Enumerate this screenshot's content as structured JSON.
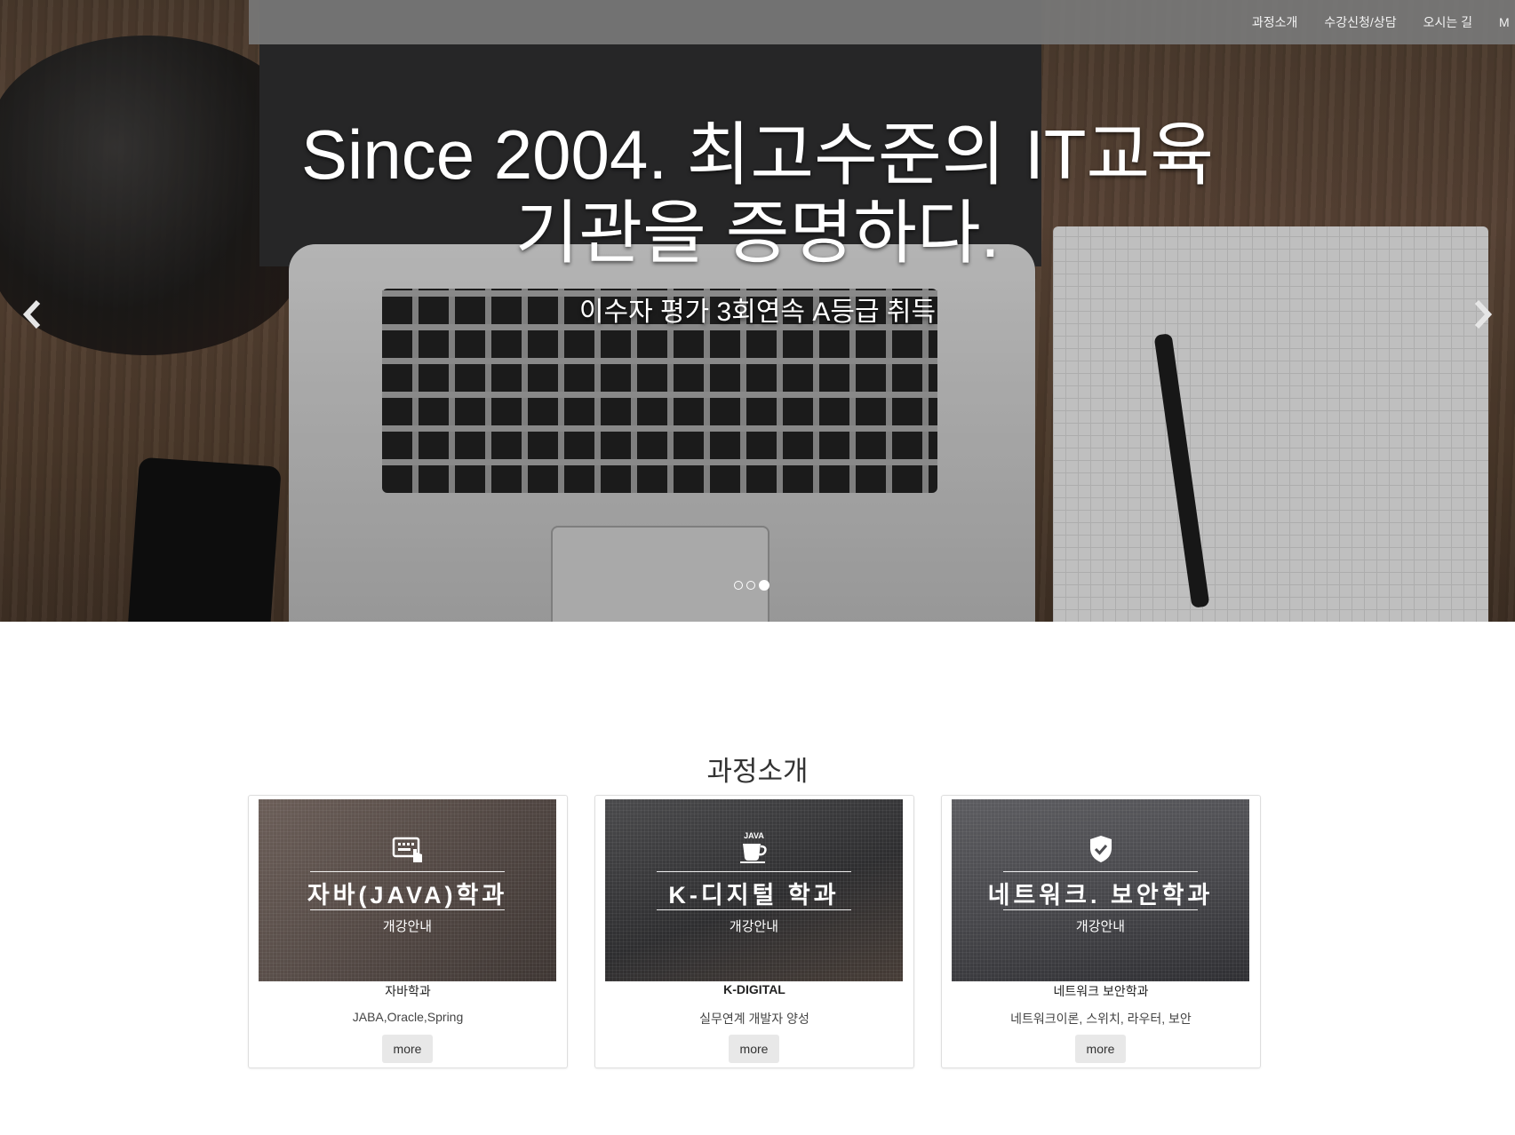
{
  "nav": {
    "items": [
      "과정소개",
      "수강신청/상담",
      "오시는 길",
      "M"
    ]
  },
  "hero": {
    "headline_line1": "Since 2004. 최고수준의 IT교육",
    "headline_line2": "기관을 증명하다.",
    "subtitle": "이수자 평가 3회연속 A등급 취득",
    "prev_icon": "chevron-left-icon",
    "next_icon": "chevron-right-icon",
    "indicator_count": 3,
    "active_indicator": 3
  },
  "section": {
    "title": "과정소개"
  },
  "cards": [
    {
      "icon": "keyboard-click-icon",
      "overlay_title": "자바(JAVA)학과",
      "overlay_sub": "개강안내",
      "name": "자바학과",
      "desc": "JABA,Oracle,Spring",
      "button": "more",
      "bg_color": "#5b4f4a"
    },
    {
      "icon": "java-coffee-icon",
      "icon_label": "JAVA",
      "overlay_title": "K-디지털 학과",
      "overlay_sub": "개강안내",
      "name": "K-DIGITAL",
      "desc": "실무연계 개발자 양성",
      "button": "more",
      "bg_color": "#3a3a3c"
    },
    {
      "icon": "shield-check-icon",
      "overlay_title": "네트워크. 보안학과",
      "overlay_sub": "개강안내",
      "name": "네트워크 보안학과",
      "desc": "네트워크이론, 스위치, 라우터, 보안",
      "button": "more",
      "bg_color": "#4e4e52"
    }
  ]
}
